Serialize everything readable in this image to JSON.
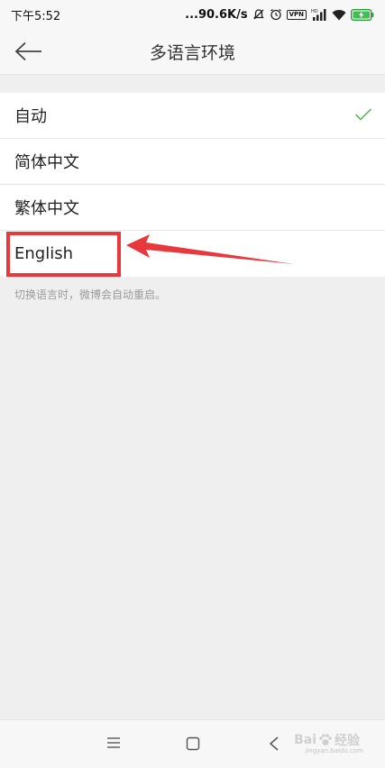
{
  "status_bar": {
    "time": "下午5:52",
    "network_speed": "...90.6K/s",
    "vpn_label": "VPN",
    "hd_label": "HD"
  },
  "header": {
    "title": "多语言环境"
  },
  "languages": [
    {
      "label": "自动",
      "selected": true
    },
    {
      "label": "简体中文",
      "selected": false
    },
    {
      "label": "繁体中文",
      "selected": false
    },
    {
      "label": "English",
      "selected": false
    }
  ],
  "hint": "切换语言时，微博会自动重启。",
  "colors": {
    "accent_check": "#5fb860",
    "annotation_red": "#e8383d",
    "background": "#efefef"
  },
  "icons": {
    "back": "arrow-left-icon",
    "check": "check-icon",
    "menu": "menu-icon",
    "home": "home-square-icon",
    "nav_back": "chevron-left-icon"
  },
  "watermark": {
    "text": "Bai",
    "text2": "经验",
    "sub": "jingyan.baidu.com"
  }
}
